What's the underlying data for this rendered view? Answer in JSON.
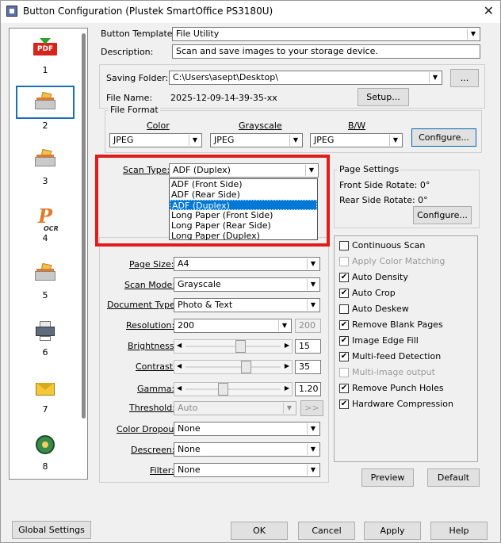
{
  "window": {
    "title": "Button Configuration (Plustek SmartOffice PS3180U)",
    "close_glyph": "✕"
  },
  "buttons_panel": {
    "items": [
      {
        "number": "1",
        "icon": "pdf-icon",
        "icon_text": "PDF"
      },
      {
        "number": "2",
        "icon": "scanner-icon",
        "selected": true
      },
      {
        "number": "3",
        "icon": "scanner-icon"
      },
      {
        "number": "4",
        "icon": "ocr-icon",
        "icon_text": "P",
        "icon_sub": "OCR"
      },
      {
        "number": "5",
        "icon": "scanner-icon"
      },
      {
        "number": "6",
        "icon": "printer-icon"
      },
      {
        "number": "7",
        "icon": "mail-icon"
      },
      {
        "number": "8",
        "icon": "ftp-icon"
      }
    ]
  },
  "template": {
    "label": "Button Template:",
    "value": "File Utility",
    "description_label": "Description:",
    "description": "Scan and save images to your storage device."
  },
  "saving": {
    "folder_label": "Saving Folder:",
    "folder_value": "C:\\Users\\asept\\Desktop\\",
    "browse_label": "...",
    "file_name_label": "File Name:",
    "file_name_value": "2025-12-09-14-39-35-xx",
    "setup_label": "Setup..."
  },
  "file_format": {
    "title": "File Format",
    "color_label": "Color",
    "grayscale_label": "Grayscale",
    "bw_label": "B/W",
    "color_value": "JPEG",
    "grayscale_value": "JPEG",
    "bw_value": "JPEG",
    "configure_label": "Configure..."
  },
  "scan_type": {
    "label": "Scan Type:",
    "value": "ADF (Duplex)",
    "options": [
      "ADF (Front Side)",
      "ADF (Rear Side)",
      "ADF (Duplex)",
      "Long Paper (Front Side)",
      "Long Paper (Rear Side)",
      "Long Paper (Duplex)"
    ],
    "selected_index": 2
  },
  "page_settings": {
    "title": "Page Settings",
    "front_rotate": "Front Side Rotate: 0°",
    "rear_rotate": "Rear Side Rotate: 0°",
    "configure_label": "Configure..."
  },
  "scan_settings": {
    "page_size_label": "Page Size:",
    "page_size_value": "A4",
    "scan_mode_label": "Scan Mode:",
    "scan_mode_value": "Grayscale",
    "document_type_label": "Document Type:",
    "document_type_value": "Photo & Text",
    "resolution_label": "Resolution:",
    "resolution_value": "200",
    "resolution_secondary": "200",
    "brightness_label": "Brightness:",
    "brightness_value": "15",
    "brightness_level": 0.58,
    "contrast_label": "Contrast:",
    "contrast_value": "35",
    "contrast_level": 0.64,
    "gamma_label": "Gamma:",
    "gamma_value": "1.20",
    "gamma_level": 0.38,
    "threshold_label": "Threshold:",
    "threshold_value": "Auto",
    "threshold_button": ">>",
    "color_dropout_label": "Color Dropout:",
    "color_dropout_value": "None",
    "descreen_label": "Descreen:",
    "descreen_value": "None",
    "filter_label": "Filter:",
    "filter_value": "None"
  },
  "options": [
    {
      "label": "Continuous Scan",
      "checked": false,
      "enabled": true
    },
    {
      "label": "Apply Color Matching",
      "checked": false,
      "enabled": false
    },
    {
      "label": "Auto Density",
      "checked": true,
      "enabled": true
    },
    {
      "label": "Auto Crop",
      "checked": true,
      "enabled": true
    },
    {
      "label": "Auto Deskew",
      "checked": false,
      "enabled": true
    },
    {
      "label": "Remove Blank Pages",
      "checked": true,
      "enabled": true
    },
    {
      "label": "Image Edge Fill",
      "checked": true,
      "enabled": true
    },
    {
      "label": "Multi-feed Detection",
      "checked": true,
      "enabled": true
    },
    {
      "label": "Multi-image output",
      "checked": false,
      "enabled": false
    },
    {
      "label": "Remove Punch Holes",
      "checked": true,
      "enabled": true
    },
    {
      "label": "Hardware Compression",
      "checked": true,
      "enabled": true
    }
  ],
  "right_buttons": {
    "preview_label": "Preview",
    "default_label": "Default"
  },
  "footer": {
    "global_settings_label": "Global Settings",
    "ok_label": "OK",
    "cancel_label": "Cancel",
    "apply_label": "Apply",
    "help_label": "Help"
  },
  "glyphs": {
    "dropdown": "▼",
    "left": "◀",
    "right": "▶",
    "check": "✔"
  },
  "colors": {
    "highlight": "#e21c1c",
    "selection": "#0078d7",
    "focus_border": "#1a6fb8"
  }
}
